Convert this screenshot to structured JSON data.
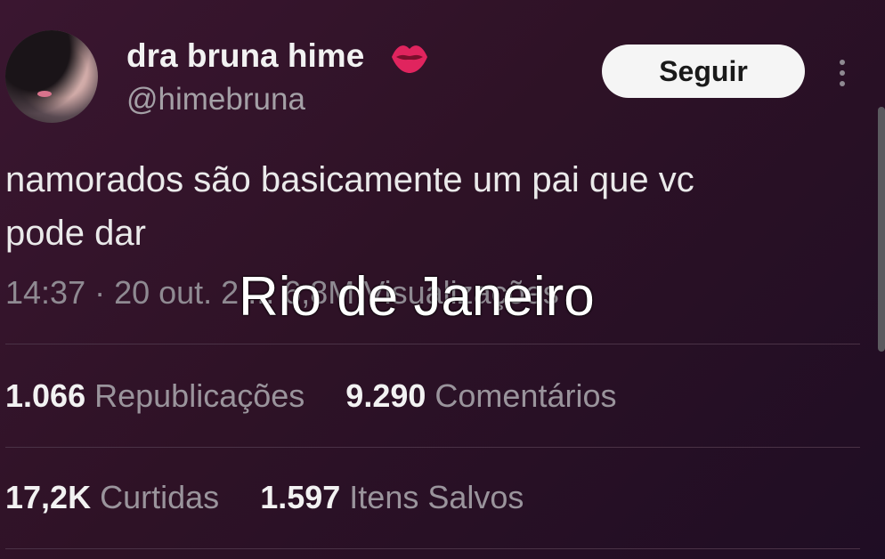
{
  "user": {
    "display_name": "dra bruna hime",
    "handle": "@himebruna"
  },
  "follow_label": "Seguir",
  "tweet": {
    "line1": "namorados são basicamente um pai que vc",
    "line2": "pode dar"
  },
  "meta": {
    "text": "14:37 · 20 out. 2 ... 6,8M Visualizações"
  },
  "overlay_text": "Rio de Janeiro",
  "stats": {
    "reposts_count": "1.066",
    "reposts_label": "Republicações",
    "comments_count": "9.290",
    "comments_label": "Comentários",
    "likes_count": "17,2K",
    "likes_label": "Curtidas",
    "saves_count": "1.597",
    "saves_label": "Itens Salvos"
  },
  "colors": {
    "background": "#2e1226",
    "follow_button": "#f5f5f5",
    "lips_emoji": "#e0245e"
  }
}
